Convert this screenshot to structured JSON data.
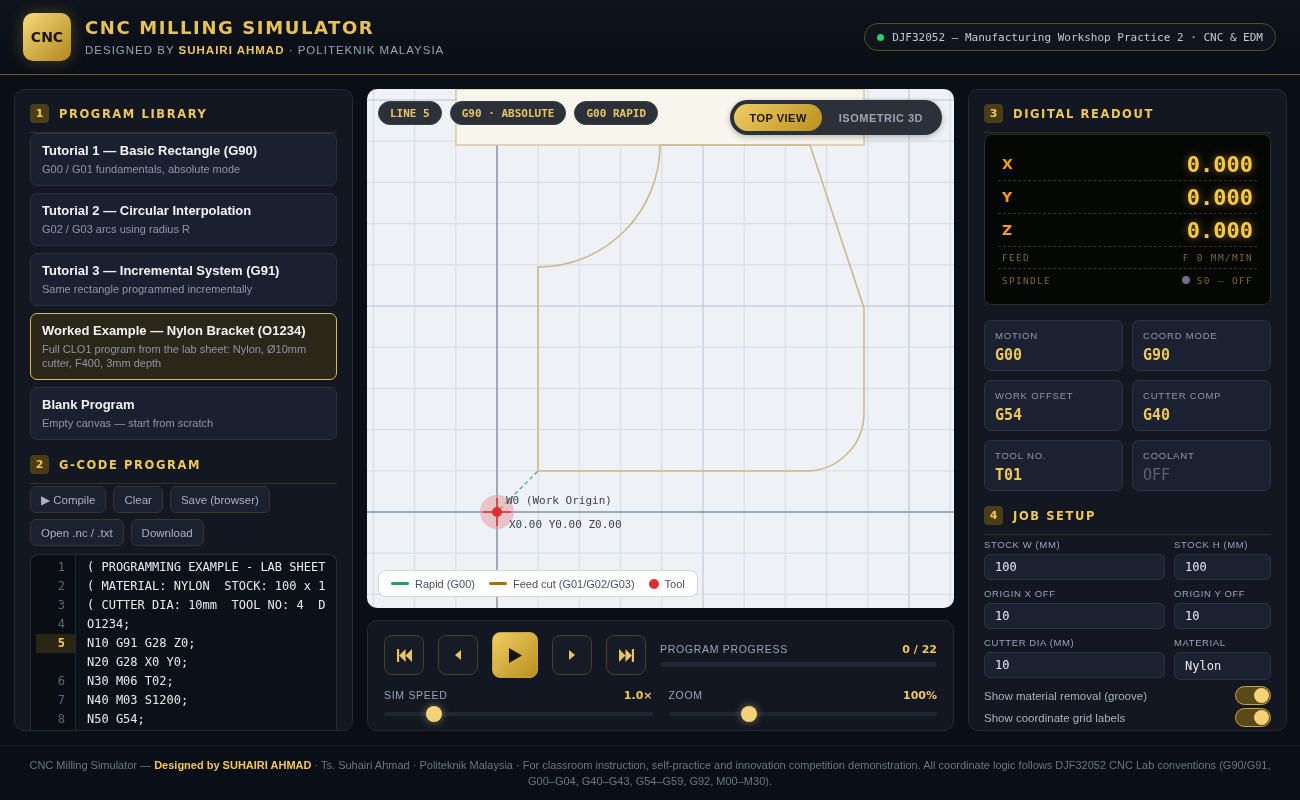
{
  "header": {
    "logo": "CNC",
    "title": "CNC MILLING SIMULATOR",
    "subtitle": "DESIGNED BY **SUHAIRI AHMAD** · POLITEKNIK MALAYSIA",
    "course": {
      "text": "DJF32052 — Manufacturing Workshop Practice 2 · CNC & EDM",
      "active": true
    }
  },
  "library": {
    "number": "1",
    "title": "PROGRAM LIBRARY",
    "programs": [
      {
        "title": "Tutorial 1 — Basic Rectangle (G90)",
        "description": "G00 / G01 fundamentals, absolute mode",
        "selected": false
      },
      {
        "title": "Tutorial 2 — Circular Interpolation",
        "description": "G02 / G03 arcs using radius R",
        "selected": false
      },
      {
        "title": "Tutorial 3 — Incremental System (G91)",
        "description": "Same rectangle programmed incrementally",
        "selected": false
      },
      {
        "title": "Worked Example — Nylon Bracket (O1234)",
        "description": "Full CLO1 program from the lab sheet: Nylon, Ø10mm cutter, F400, 3mm depth",
        "selected": true
      },
      {
        "title": "Blank Program",
        "description": "Empty canvas — start from scratch",
        "selected": false
      }
    ]
  },
  "editor": {
    "number": "2",
    "title": "G-CODE PROGRAM",
    "buttons": [
      "▶ Compile",
      "Clear",
      "Save (browser)",
      "Open .nc / .txt",
      "Download"
    ],
    "lines": [
      {
        "number": "1",
        "code": "( PROGRAMMING EXAMPLE - LAB SHEET",
        "current": false
      },
      {
        "number": "2",
        "code": "( MATERIAL: NYLON  STOCK: 100 x 1",
        "current": false
      },
      {
        "number": "3",
        "code": "( CUTTER DIA: 10mm  TOOL NO: 4  D",
        "current": false
      },
      {
        "number": "4",
        "code": "O1234;",
        "current": false
      },
      {
        "number": "5",
        "code": "N10 G91 G28 Z0;",
        "current": true
      },
      {
        "code": "N20 G28 X0 Y0;",
        "current": false
      },
      {
        "number": "6",
        "code": "N30 M06 T02;",
        "current": false
      },
      {
        "number": "7",
        "code": "N40 M03 S1200;",
        "current": false
      },
      {
        "number": "8",
        "code": "N50 G54;",
        "current": false
      }
    ]
  },
  "viewport": {
    "badges": [
      "LINE 5",
      "G90 · ABSOLUTE",
      "G00 RAPID"
    ],
    "views": [
      {
        "label": "TOP VIEW",
        "selected": true
      },
      {
        "label": "ISOMETRIC 3D",
        "selected": false
      }
    ],
    "origin_label": "W0 (Work Origin)",
    "position_label": "X0.00 Y0.00 Z0.00",
    "legend": [
      {
        "kind": "line",
        "label": "Rapid (G00)",
        "color": "#1fa15a"
      },
      {
        "kind": "line",
        "label": "Feed cut (G01/G02/G03)",
        "color": "#a8700f"
      },
      {
        "kind": "dot",
        "label": "Tool",
        "color": "#dc2f2f"
      }
    ]
  },
  "playback": {
    "buttons": [
      {
        "kind": "first"
      },
      {
        "kind": "previous"
      },
      {
        "kind": "play"
      },
      {
        "kind": "next"
      },
      {
        "kind": "last"
      }
    ],
    "progress": {
      "label": "PROGRAM PROGRESS",
      "reading": "0 / 22",
      "level": 0
    },
    "sliders": [
      {
        "label": "SIM SPEED",
        "reading": "1.0×",
        "level": 0.185
      },
      {
        "label": "ZOOM",
        "reading": "100%",
        "level": 0.3
      }
    ]
  },
  "readout": {
    "number": "3",
    "title": "DIGITAL READOUT",
    "axes": [
      {
        "axis": "X",
        "value": "0.000"
      },
      {
        "axis": "Y",
        "value": "0.000"
      },
      {
        "axis": "Z",
        "value": "0.000"
      }
    ],
    "feed": {
      "label": "FEED",
      "value": "F 0 MM/MIN"
    },
    "spindle": {
      "label": "SPINDLE",
      "value": "S0 — OFF",
      "on": false
    }
  },
  "modal_states": [
    {
      "label": "MOTION",
      "value": "G00",
      "off": false
    },
    {
      "label": "COORD MODE",
      "value": "G90",
      "off": false
    },
    {
      "label": "WORK OFFSET",
      "value": "G54",
      "off": false
    },
    {
      "label": "CUTTER COMP",
      "value": "G40",
      "off": false
    },
    {
      "label": "TOOL NO.",
      "value": "T01",
      "off": false
    },
    {
      "label": "COOLANT",
      "value": "OFF",
      "off": true
    }
  ],
  "job_setup": {
    "number": "4",
    "title": "JOB SETUP",
    "fields": [
      {
        "kind": "input",
        "label": "STOCK W (MM)",
        "value": "100"
      },
      {
        "kind": "input",
        "label": "STOCK H (MM)",
        "value": "100"
      },
      {
        "kind": "input",
        "label": "ORIGIN X OFF",
        "value": "10"
      },
      {
        "kind": "input",
        "label": "ORIGIN Y OFF",
        "value": "10"
      },
      {
        "kind": "input",
        "label": "CUTTER DIA (MM)",
        "value": "10"
      },
      {
        "kind": "select",
        "label": "MATERIAL",
        "value": "Nylon"
      }
    ],
    "toggles": [
      {
        "label": "Show material removal (groove)",
        "on": true
      },
      {
        "label": "Show coordinate grid labels",
        "on": true
      }
    ]
  },
  "footer": "CNC Milling Simulator — **Designed by SUHAIRI AHMAD** · Ts. Suhairi Ahmad · Politeknik Malaysia · For classroom instruction, self-practice and innovation competition demonstration. All coordinate logic follows DJF32052 CNC Lab conventions (G90/G91, G00–G04, G40–G43, G54–G59, G92, M00–M30)."
}
